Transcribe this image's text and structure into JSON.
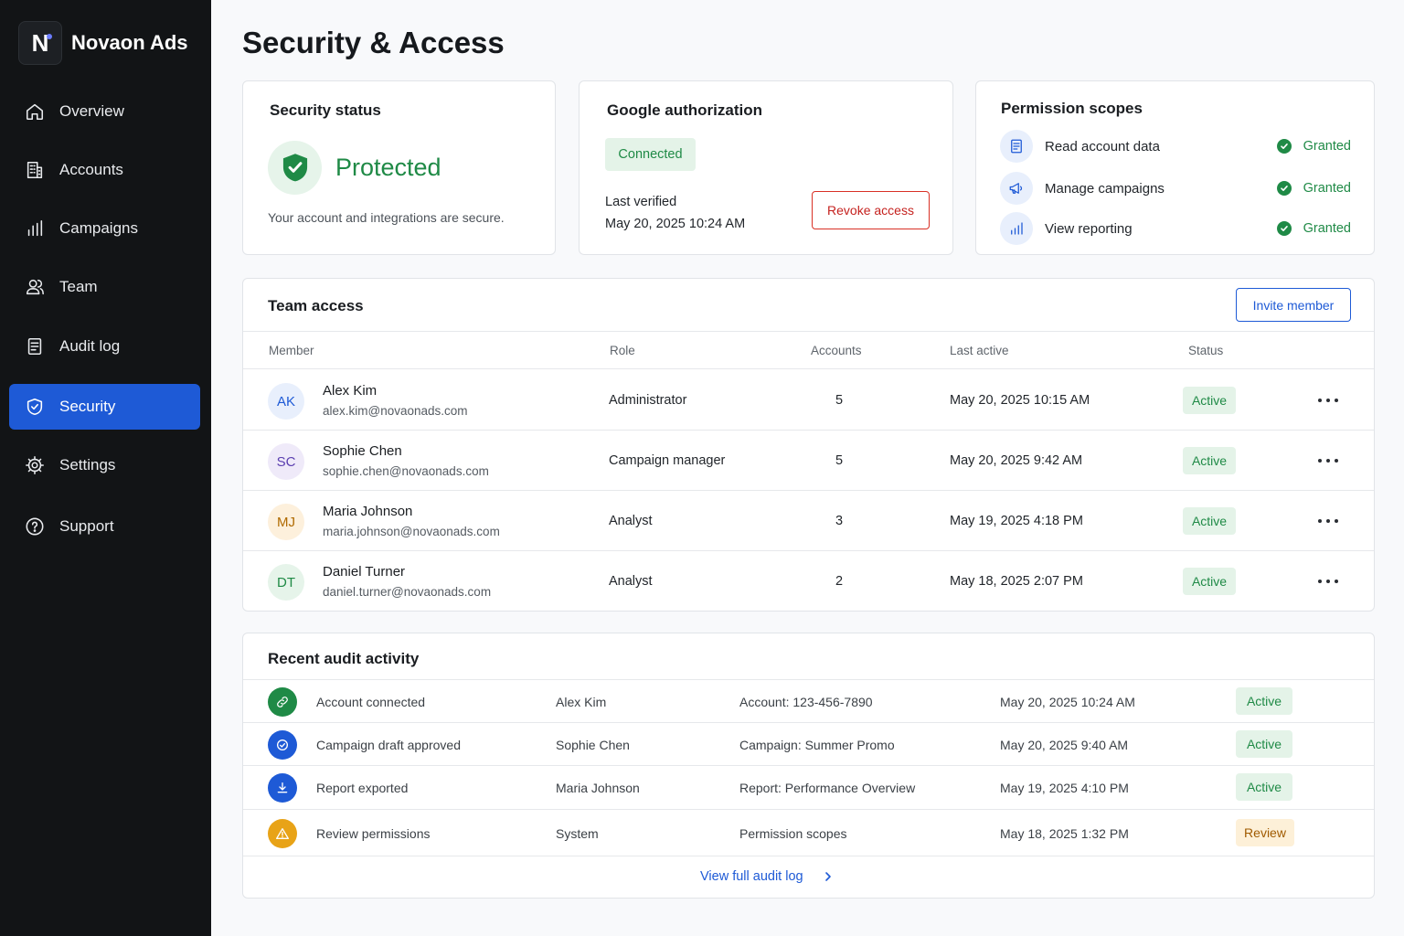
{
  "app": {
    "logo_letter": "N",
    "name": "Novaon Ads"
  },
  "sidebar": {
    "items": [
      {
        "label": "Overview",
        "icon": "home-icon"
      },
      {
        "label": "Accounts",
        "icon": "building-icon"
      },
      {
        "label": "Campaigns",
        "icon": "bar-chart-icon"
      },
      {
        "label": "Team",
        "icon": "users-icon"
      },
      {
        "label": "Audit log",
        "icon": "document-icon"
      },
      {
        "label": "Security",
        "icon": "shield-icon",
        "active": true
      },
      {
        "label": "Settings",
        "icon": "gear-icon"
      },
      {
        "label": "Support",
        "icon": "help-icon"
      }
    ]
  },
  "page": {
    "title": "Security & Access"
  },
  "security_status": {
    "title": "Security status",
    "status": "Protected",
    "description": "Your account and integrations are secure."
  },
  "google_auth": {
    "title": "Google authorization",
    "badge": "Connected",
    "last_verified_label": "Last verified",
    "last_verified_value": "May 20, 2025  10:24 AM",
    "revoke_label": "Revoke access"
  },
  "permission_scopes": {
    "title": "Permission scopes",
    "items": [
      {
        "label": "Read account data",
        "status": "Granted",
        "icon": "document-icon"
      },
      {
        "label": "Manage campaigns",
        "status": "Granted",
        "icon": "megaphone-icon"
      },
      {
        "label": "View reporting",
        "status": "Granted",
        "icon": "bar-chart-icon"
      }
    ]
  },
  "team": {
    "title": "Team access",
    "invite_label": "Invite member",
    "columns": {
      "member": "Member",
      "role": "Role",
      "accounts": "Accounts",
      "last_active": "Last active",
      "status": "Status"
    },
    "rows": [
      {
        "initials": "AK",
        "name": "Alex Kim",
        "email": "alex.kim@novaonads.com",
        "role": "Administrator",
        "accounts": "5",
        "last_active": "May 20, 2025  10:15 AM",
        "status": "Active",
        "avatar_bg": "#e8effc",
        "avatar_fg": "#1e5ad6"
      },
      {
        "initials": "SC",
        "name": "Sophie Chen",
        "email": "sophie.chen@novaonads.com",
        "role": "Campaign manager",
        "accounts": "5",
        "last_active": "May 20, 2025  9:42 AM",
        "status": "Active",
        "avatar_bg": "#efeaf9",
        "avatar_fg": "#5b3fb0"
      },
      {
        "initials": "MJ",
        "name": "Maria Johnson",
        "email": "maria.johnson@novaonads.com",
        "role": "Analyst",
        "accounts": "3",
        "last_active": "May 19, 2025  4:18 PM",
        "status": "Active",
        "avatar_bg": "#fdf0dc",
        "avatar_fg": "#b06a00"
      },
      {
        "initials": "DT",
        "name": "Daniel Turner",
        "email": "daniel.turner@novaonads.com",
        "role": "Analyst",
        "accounts": "2",
        "last_active": "May 18, 2025  2:07 PM",
        "status": "Active",
        "avatar_bg": "#e6f4ea",
        "avatar_fg": "#1f8a46"
      }
    ]
  },
  "audit": {
    "title": "Recent audit activity",
    "rows": [
      {
        "event": "Account connected",
        "actor": "Alex Kim",
        "target": "Account: 123-456-7890",
        "time": "May 20, 2025  10:24 AM",
        "status": "Active",
        "icon": "link-icon",
        "icon_bg": "#1f8a46"
      },
      {
        "event": "Campaign draft approved",
        "actor": "Sophie Chen",
        "target": "Campaign: Summer Promo",
        "time": "May 20, 2025  9:40 AM",
        "status": "Active",
        "icon": "check-circle-icon",
        "icon_bg": "#1e5ad6"
      },
      {
        "event": "Report exported",
        "actor": "Maria Johnson",
        "target": "Report: Performance Overview",
        "time": "May 19, 2025  4:10 PM",
        "status": "Active",
        "icon": "download-icon",
        "icon_bg": "#1e5ad6"
      },
      {
        "event": "Review permissions",
        "actor": "System",
        "target": "Permission scopes",
        "time": "May 18, 2025  1:32 PM",
        "status": "Review",
        "icon": "warning-icon",
        "icon_bg": "#e8a317"
      }
    ],
    "footer_link": "View full audit log"
  },
  "colors": {
    "accent": "#1e5ad6",
    "success": "#1f8a46",
    "danger": "#d93025",
    "sidebar_bg": "#121416"
  }
}
